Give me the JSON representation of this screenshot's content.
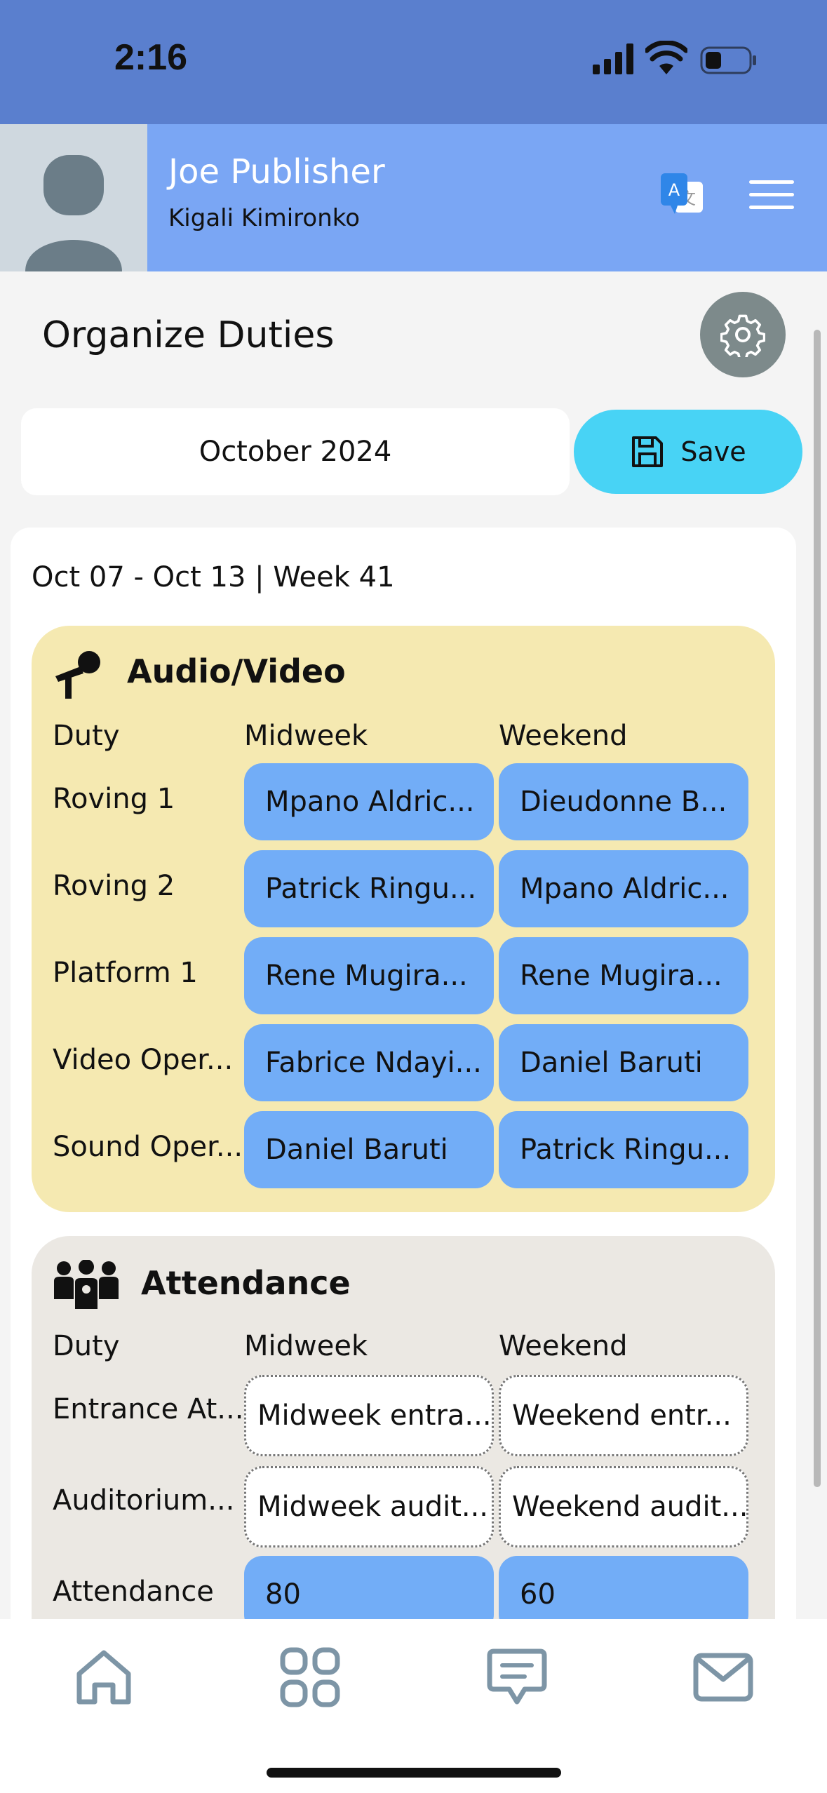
{
  "status_bar": {
    "time": "2:16"
  },
  "header": {
    "user_name": "Joe Publisher",
    "congregation": "Kigali Kimironko"
  },
  "page": {
    "title": "Organize Duties"
  },
  "month_selector": {
    "value": "October 2024"
  },
  "save_button": {
    "label": "Save"
  },
  "week": {
    "label": "Oct 07 -  Oct 13 | Week 41"
  },
  "audio_video": {
    "title": "Audio/Video",
    "columns": {
      "duty": "Duty",
      "midweek": "Midweek",
      "weekend": "Weekend"
    },
    "rows": [
      {
        "duty": "Roving 1",
        "midweek": "Mpano Aldric...",
        "weekend": "Dieudonne B..."
      },
      {
        "duty": "Roving 2",
        "midweek": "Patrick Ringu...",
        "weekend": "Mpano Aldric..."
      },
      {
        "duty": "Platform 1",
        "midweek": "Rene  Mugira...",
        "weekend": "Rene  Mugira..."
      },
      {
        "duty": "Video Oper...",
        "midweek": "Fabrice Ndayi...",
        "weekend": "Daniel Baruti"
      },
      {
        "duty": "Sound Oper...",
        "midweek": "Daniel Baruti",
        "weekend": "Patrick Ringu..."
      }
    ]
  },
  "attendance": {
    "title": "Attendance",
    "columns": {
      "duty": "Duty",
      "midweek": "Midweek",
      "weekend": "Weekend"
    },
    "rows": [
      {
        "duty": "Entrance At...",
        "midweek": "Midweek entra...",
        "weekend": "Weekend entr..."
      },
      {
        "duty": "Auditorium...",
        "midweek": "Midweek audit...",
        "weekend": "Weekend audit..."
      },
      {
        "duty": "Attendance",
        "midweek": "80",
        "weekend": "60"
      }
    ]
  },
  "bottom_nav": {
    "items": [
      {
        "icon": "home-icon"
      },
      {
        "icon": "grid-icon"
      },
      {
        "icon": "chat-icon"
      },
      {
        "icon": "mail-icon"
      }
    ]
  },
  "colors": {
    "status_bar": "#5a7fce",
    "header": "#7aa6f4",
    "save_button": "#48d3f5",
    "assigned_cell": "#72adf7",
    "audio_video_section": "#f5e9b1",
    "attendance_section": "#ebe8e3",
    "settings_button": "#7d8a8b"
  }
}
